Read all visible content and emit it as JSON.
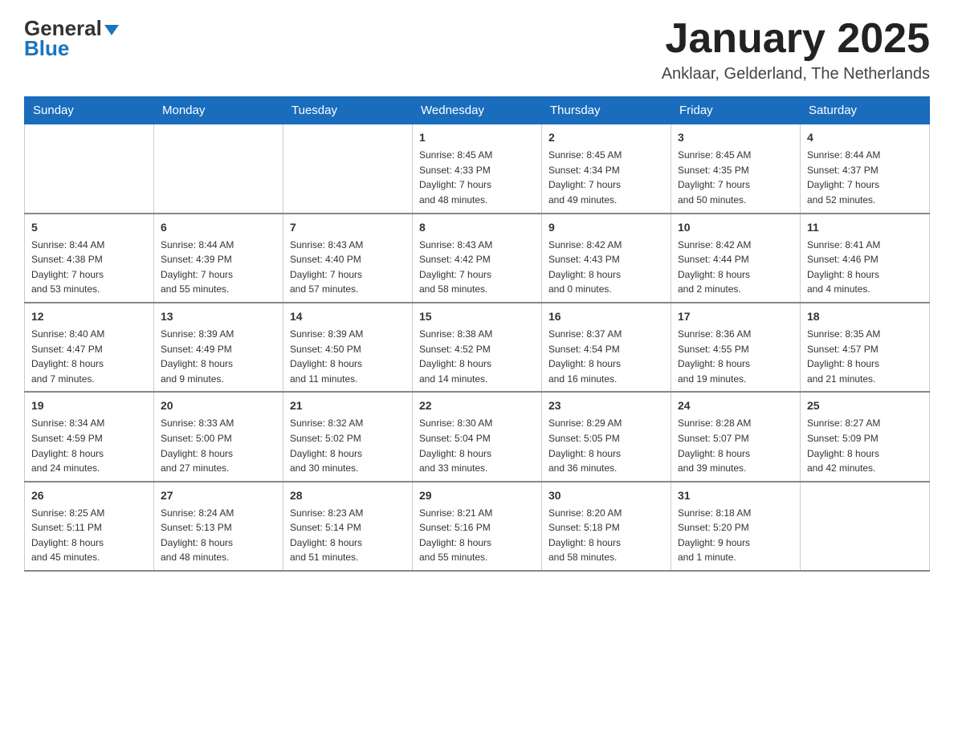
{
  "header": {
    "logo": {
      "general": "General",
      "blue": "Blue"
    },
    "title": "January 2025",
    "location": "Anklaar, Gelderland, The Netherlands"
  },
  "calendar": {
    "days_of_week": [
      "Sunday",
      "Monday",
      "Tuesday",
      "Wednesday",
      "Thursday",
      "Friday",
      "Saturday"
    ],
    "weeks": [
      [
        {
          "day": "",
          "info": ""
        },
        {
          "day": "",
          "info": ""
        },
        {
          "day": "",
          "info": ""
        },
        {
          "day": "1",
          "info": "Sunrise: 8:45 AM\nSunset: 4:33 PM\nDaylight: 7 hours\nand 48 minutes."
        },
        {
          "day": "2",
          "info": "Sunrise: 8:45 AM\nSunset: 4:34 PM\nDaylight: 7 hours\nand 49 minutes."
        },
        {
          "day": "3",
          "info": "Sunrise: 8:45 AM\nSunset: 4:35 PM\nDaylight: 7 hours\nand 50 minutes."
        },
        {
          "day": "4",
          "info": "Sunrise: 8:44 AM\nSunset: 4:37 PM\nDaylight: 7 hours\nand 52 minutes."
        }
      ],
      [
        {
          "day": "5",
          "info": "Sunrise: 8:44 AM\nSunset: 4:38 PM\nDaylight: 7 hours\nand 53 minutes."
        },
        {
          "day": "6",
          "info": "Sunrise: 8:44 AM\nSunset: 4:39 PM\nDaylight: 7 hours\nand 55 minutes."
        },
        {
          "day": "7",
          "info": "Sunrise: 8:43 AM\nSunset: 4:40 PM\nDaylight: 7 hours\nand 57 minutes."
        },
        {
          "day": "8",
          "info": "Sunrise: 8:43 AM\nSunset: 4:42 PM\nDaylight: 7 hours\nand 58 minutes."
        },
        {
          "day": "9",
          "info": "Sunrise: 8:42 AM\nSunset: 4:43 PM\nDaylight: 8 hours\nand 0 minutes."
        },
        {
          "day": "10",
          "info": "Sunrise: 8:42 AM\nSunset: 4:44 PM\nDaylight: 8 hours\nand 2 minutes."
        },
        {
          "day": "11",
          "info": "Sunrise: 8:41 AM\nSunset: 4:46 PM\nDaylight: 8 hours\nand 4 minutes."
        }
      ],
      [
        {
          "day": "12",
          "info": "Sunrise: 8:40 AM\nSunset: 4:47 PM\nDaylight: 8 hours\nand 7 minutes."
        },
        {
          "day": "13",
          "info": "Sunrise: 8:39 AM\nSunset: 4:49 PM\nDaylight: 8 hours\nand 9 minutes."
        },
        {
          "day": "14",
          "info": "Sunrise: 8:39 AM\nSunset: 4:50 PM\nDaylight: 8 hours\nand 11 minutes."
        },
        {
          "day": "15",
          "info": "Sunrise: 8:38 AM\nSunset: 4:52 PM\nDaylight: 8 hours\nand 14 minutes."
        },
        {
          "day": "16",
          "info": "Sunrise: 8:37 AM\nSunset: 4:54 PM\nDaylight: 8 hours\nand 16 minutes."
        },
        {
          "day": "17",
          "info": "Sunrise: 8:36 AM\nSunset: 4:55 PM\nDaylight: 8 hours\nand 19 minutes."
        },
        {
          "day": "18",
          "info": "Sunrise: 8:35 AM\nSunset: 4:57 PM\nDaylight: 8 hours\nand 21 minutes."
        }
      ],
      [
        {
          "day": "19",
          "info": "Sunrise: 8:34 AM\nSunset: 4:59 PM\nDaylight: 8 hours\nand 24 minutes."
        },
        {
          "day": "20",
          "info": "Sunrise: 8:33 AM\nSunset: 5:00 PM\nDaylight: 8 hours\nand 27 minutes."
        },
        {
          "day": "21",
          "info": "Sunrise: 8:32 AM\nSunset: 5:02 PM\nDaylight: 8 hours\nand 30 minutes."
        },
        {
          "day": "22",
          "info": "Sunrise: 8:30 AM\nSunset: 5:04 PM\nDaylight: 8 hours\nand 33 minutes."
        },
        {
          "day": "23",
          "info": "Sunrise: 8:29 AM\nSunset: 5:05 PM\nDaylight: 8 hours\nand 36 minutes."
        },
        {
          "day": "24",
          "info": "Sunrise: 8:28 AM\nSunset: 5:07 PM\nDaylight: 8 hours\nand 39 minutes."
        },
        {
          "day": "25",
          "info": "Sunrise: 8:27 AM\nSunset: 5:09 PM\nDaylight: 8 hours\nand 42 minutes."
        }
      ],
      [
        {
          "day": "26",
          "info": "Sunrise: 8:25 AM\nSunset: 5:11 PM\nDaylight: 8 hours\nand 45 minutes."
        },
        {
          "day": "27",
          "info": "Sunrise: 8:24 AM\nSunset: 5:13 PM\nDaylight: 8 hours\nand 48 minutes."
        },
        {
          "day": "28",
          "info": "Sunrise: 8:23 AM\nSunset: 5:14 PM\nDaylight: 8 hours\nand 51 minutes."
        },
        {
          "day": "29",
          "info": "Sunrise: 8:21 AM\nSunset: 5:16 PM\nDaylight: 8 hours\nand 55 minutes."
        },
        {
          "day": "30",
          "info": "Sunrise: 8:20 AM\nSunset: 5:18 PM\nDaylight: 8 hours\nand 58 minutes."
        },
        {
          "day": "31",
          "info": "Sunrise: 8:18 AM\nSunset: 5:20 PM\nDaylight: 9 hours\nand 1 minute."
        },
        {
          "day": "",
          "info": ""
        }
      ]
    ]
  }
}
